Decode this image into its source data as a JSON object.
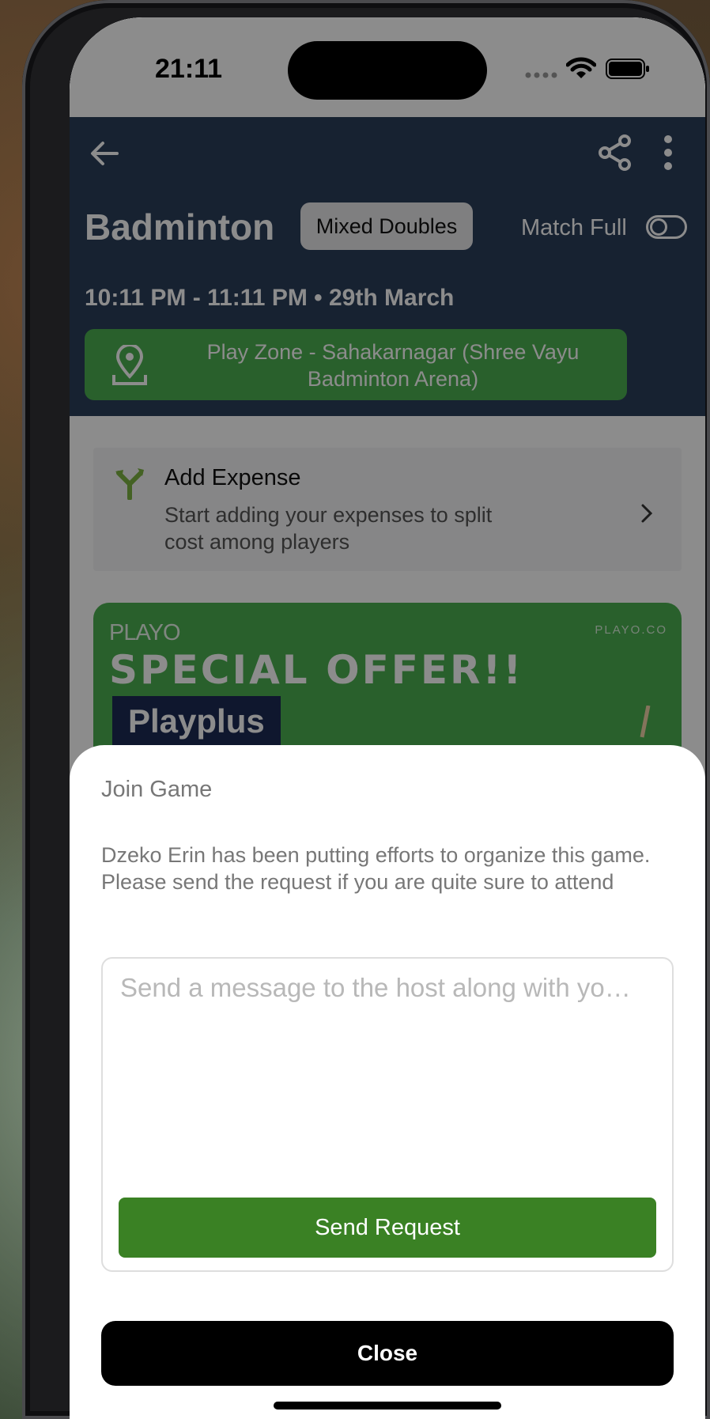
{
  "status_bar": {
    "time": "21:11"
  },
  "header": {
    "sport": "Badminton",
    "match_type": "Mixed Doubles",
    "match_full_label": "Match Full",
    "time_date": "10:11 PM - 11:11 PM • 29th March",
    "venue": "Play Zone - Sahakarnagar (Shree Vayu Badminton Arena)",
    "icons": [
      "back-arrow-icon",
      "share-icon",
      "more-vertical-icon",
      "location-pin-icon"
    ]
  },
  "expense": {
    "title": "Add Expense",
    "description": "Start adding your expenses to split cost among players"
  },
  "offer": {
    "logo": "PLAYO",
    "site": "PLAYO.CO",
    "title": "SPECIAL OFFER!!",
    "subtitle": "Playplus"
  },
  "sheet": {
    "title": "Join Game",
    "description": "Dzeko Erin has been putting efforts to organize this game. Please send the request if you are quite sure to attend",
    "message_placeholder": "Send a message to the host along with yo…",
    "message_value": "",
    "send_label": "Send Request",
    "close_label": "Close"
  },
  "colors": {
    "header_bg": "#2b3e5a",
    "venue_bg": "#4caf50",
    "send_button": "#3a8124",
    "close_button": "#000000"
  }
}
